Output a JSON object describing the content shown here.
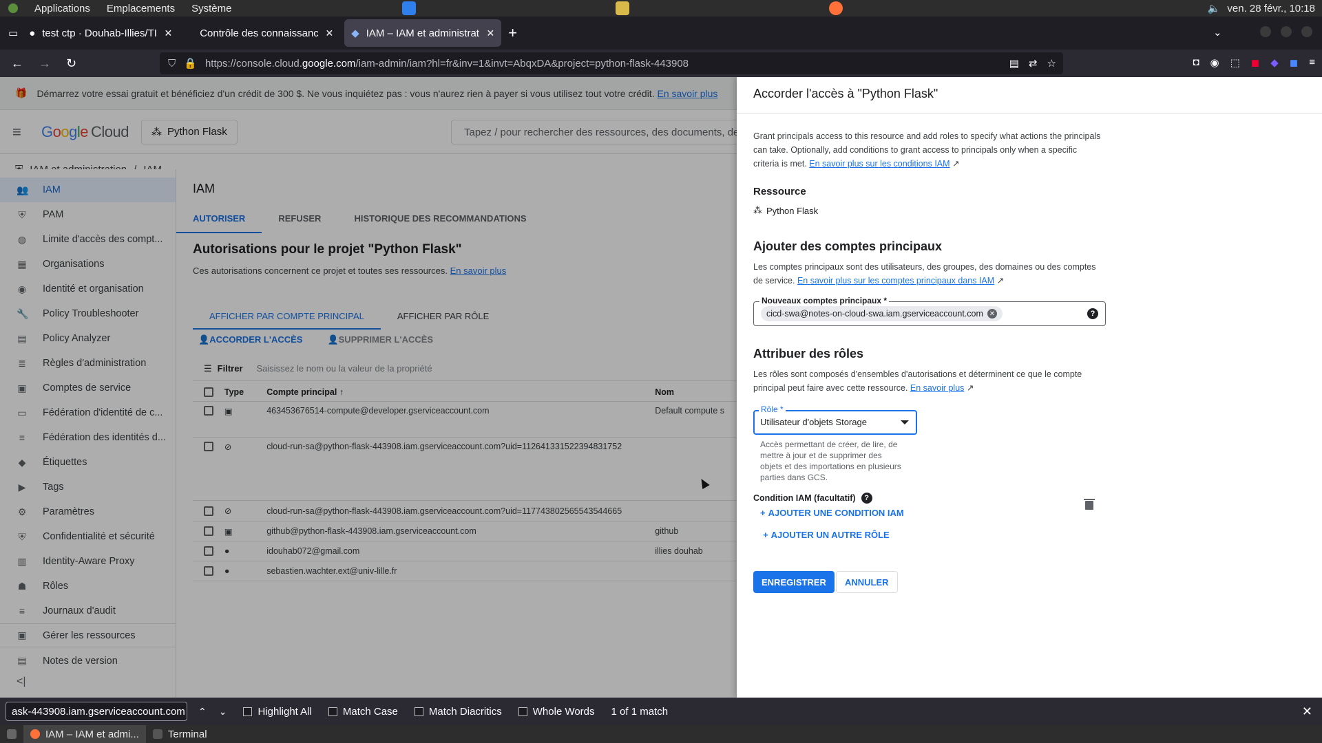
{
  "os": {
    "menu": [
      "Applications",
      "Emplacements",
      "Système"
    ],
    "datetime": "ven. 28 févr., 10:18"
  },
  "browser": {
    "tabs": [
      {
        "title": "test ctp · Douhab-Illies/TI"
      },
      {
        "title": "Contrôle des connaissanc"
      },
      {
        "title": "IAM – IAM et administrati"
      }
    ],
    "url_prefix": "https://console.cloud.",
    "url_domain": "google.com",
    "url_rest": "/iam-admin/iam?hl=fr&inv=1&invt=AbqxDA&project=python-flask-443908"
  },
  "banner": {
    "text": "Démarrez votre essai gratuit et bénéficiez d'un crédit de 300 $. Ne vous inquiétez pas : vous n'aurez rien à payer si vous utilisez tout votre crédit.",
    "link": "En savoir plus"
  },
  "header": {
    "logo_google": [
      "G",
      "o",
      "o",
      "g",
      "l",
      "e"
    ],
    "logo_cloud": "Cloud",
    "project": "Python Flask",
    "search_placeholder": "Tapez / pour rechercher des ressources, des documents, des pr"
  },
  "breadcrumb": {
    "first": "IAM et administration",
    "sep": "/",
    "second": "IAM"
  },
  "sidebar": {
    "items": [
      {
        "label": "IAM",
        "icon": "👥"
      },
      {
        "label": "PAM",
        "icon": "⛨"
      },
      {
        "label": "Limite d'accès des compt...",
        "icon": "◍"
      },
      {
        "label": "Organisations",
        "icon": "▦"
      },
      {
        "label": "Identité et organisation",
        "icon": "◉"
      },
      {
        "label": "Policy Troubleshooter",
        "icon": "🔧"
      },
      {
        "label": "Policy Analyzer",
        "icon": "▤"
      },
      {
        "label": "Règles d'administration",
        "icon": "≣"
      },
      {
        "label": "Comptes de service",
        "icon": "▣"
      },
      {
        "label": "Fédération d'identité de c...",
        "icon": "▭"
      },
      {
        "label": "Fédération des identités d...",
        "icon": "≡"
      },
      {
        "label": "Étiquettes",
        "icon": "◆"
      },
      {
        "label": "Tags",
        "icon": "▶"
      },
      {
        "label": "Paramètres",
        "icon": "⚙"
      },
      {
        "label": "Confidentialité et sécurité",
        "icon": "⛨"
      },
      {
        "label": "Identity-Aware Proxy",
        "icon": "▥"
      },
      {
        "label": "Rôles",
        "icon": "☗"
      },
      {
        "label": "Journaux d'audit",
        "icon": "≡"
      },
      {
        "label": "Gérer les ressources",
        "icon": "▣"
      },
      {
        "label": "Notes de version",
        "icon": "▤"
      }
    ],
    "collapse": "<|"
  },
  "main": {
    "title": "IAM",
    "tabs": [
      "AUTORISER",
      "REFUSER",
      "HISTORIQUE DES RECOMMANDATIONS"
    ],
    "heading": "Autorisations pour le projet \"Python Flask\"",
    "description": "Ces autorisations concernent ce projet et toutes ses ressources.",
    "desc_link": "En savoir plus",
    "view_tabs": [
      "AFFICHER PAR COMPTE PRINCIPAL",
      "AFFICHER PAR RÔLE"
    ],
    "grant_action": "ACCORDER L'ACCÈS",
    "remove_action": "SUPPRIMER L'ACCÈS",
    "filter_label": "Filtrer",
    "filter_placeholder": "Saisissez le nom ou la valeur de la propriété",
    "columns": {
      "type": "Type",
      "principal": "Compte principal",
      "name": "Nom"
    },
    "rows": [
      {
        "principal": "463453676514-compute@developer.gserviceaccount.com",
        "name": "Default compute s",
        "icon": "▣"
      },
      {
        "principal": "cloud-run-sa@python-flask-443908.iam.gserviceaccount.com?uid=112641331522394831752",
        "name": "",
        "icon": "⊘"
      },
      {
        "principal": "cloud-run-sa@python-flask-443908.iam.gserviceaccount.com?uid=117743802565543544665",
        "name": "",
        "icon": "⊘"
      },
      {
        "principal": "github@python-flask-443908.iam.gserviceaccount.com",
        "name": "github",
        "icon": "▣"
      },
      {
        "principal": "idouhab072@gmail.com",
        "name": "illies douhab",
        "icon": "●"
      },
      {
        "principal": "sebastien.wachter.ext@univ-lille.fr",
        "name": "",
        "icon": "●"
      }
    ]
  },
  "panel": {
    "title": "Accorder l'accès à \"Python Flask\"",
    "intro": "Grant principals access to this resource and add roles to specify what actions the principals can take. Optionally, add conditions to grant access to principals only when a specific criteria is met.",
    "intro_link": "En savoir plus sur les conditions IAM",
    "resource_label": "Ressource",
    "resource_value": "Python Flask",
    "add_principals_heading": "Ajouter des comptes principaux",
    "add_principals_text": "Les comptes principaux sont des utilisateurs, des groupes, des domaines ou des comptes de service.",
    "add_principals_link": "En savoir plus sur les comptes principaux dans IAM",
    "principals_field_label": "Nouveaux comptes principaux *",
    "principal_chip": "cicd-swa@notes-on-cloud-swa.iam.gserviceaccount.com",
    "roles_heading": "Attribuer des rôles",
    "roles_text": "Les rôles sont composés d'ensembles d'autorisations et déterminent ce que le compte principal peut faire avec cette ressource.",
    "roles_link": "En savoir plus",
    "role_label": "Rôle *",
    "role_value": "Utilisateur d'objets Storage",
    "role_help": "Accès permettant de créer, de lire, de mettre à jour et de supprimer des objets et des importations en plusieurs parties dans GCS.",
    "condition_label": "Condition IAM (facultatif)",
    "add_condition": "AJOUTER UNE CONDITION IAM",
    "add_role": "AJOUTER UN AUTRE RÔLE",
    "save": "ENREGISTRER",
    "cancel": "ANNULER"
  },
  "findbar": {
    "query": "ask-443908.iam.gserviceaccount.com",
    "options": [
      "Highlight All",
      "Match Case",
      "Match Diacritics",
      "Whole Words"
    ],
    "count": "1 of 1 match"
  },
  "taskbar": {
    "items": [
      "IAM – IAM et admi...",
      "Terminal"
    ]
  },
  "colors": {
    "accent": "#1a73e8",
    "overlay": "rgba(0,0,0,0.32)"
  }
}
